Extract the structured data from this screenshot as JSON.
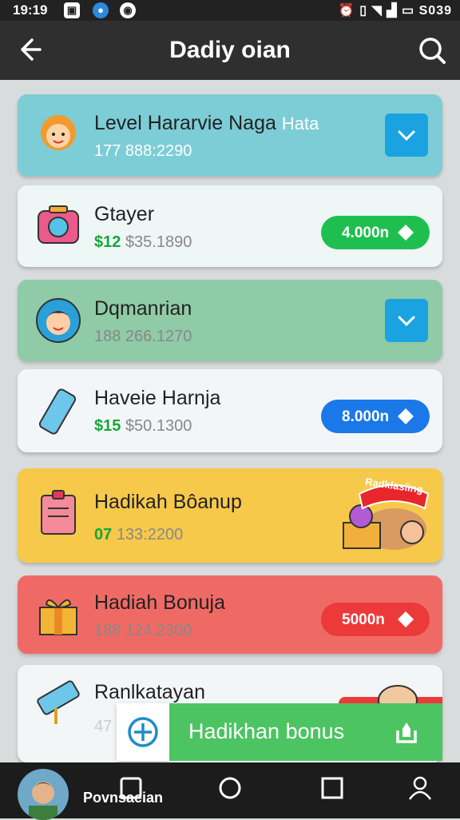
{
  "status_bar": {
    "time": "19:19",
    "right_text": "S039"
  },
  "app_bar": {
    "title": "Dadiy oian"
  },
  "cards": [
    {
      "title": "Level Hararvie Naga",
      "title_tag": "Hata",
      "subtitle": "177 888:2290",
      "action": "check",
      "bg": "#7dcdd6"
    },
    {
      "title": "Gtayer",
      "subtitle_green": "$12",
      "subtitle": "$35.1890",
      "action": "pill",
      "pill_label": "4.000n",
      "pill_color": "#1fbf4f",
      "bg": "#eef6f6"
    },
    {
      "title": "Dqmanrian",
      "subtitle": "188 266.1270",
      "action": "check",
      "bg": "#8fcba6"
    },
    {
      "title": "Haveie Harnja",
      "subtitle_green": "$15",
      "subtitle": "$50.1300",
      "action": "pill",
      "pill_label": "8.000n",
      "pill_color": "#1b78e8",
      "bg": "#f3f6f8"
    },
    {
      "title": "Hadikah Bôanup",
      "subtitle_green": "07",
      "subtitle": "133:2200",
      "action": "art",
      "art_label": "Radklasiing",
      "bg": "#f7c94a"
    },
    {
      "title": "Hadiah Bonuja",
      "subtitle": "188 124.2300",
      "action": "pill",
      "pill_label": "5000n",
      "pill_color": "#ec3a3a",
      "bg": "#f06a65"
    },
    {
      "title": "Ranlkatayan",
      "subtitle": "47",
      "action": "none",
      "bg": "#f3f6f7"
    }
  ],
  "floating_bar": {
    "label": "Hadikhan bonus"
  },
  "bottom_nav": {
    "user_name": "Povnsaeian"
  }
}
